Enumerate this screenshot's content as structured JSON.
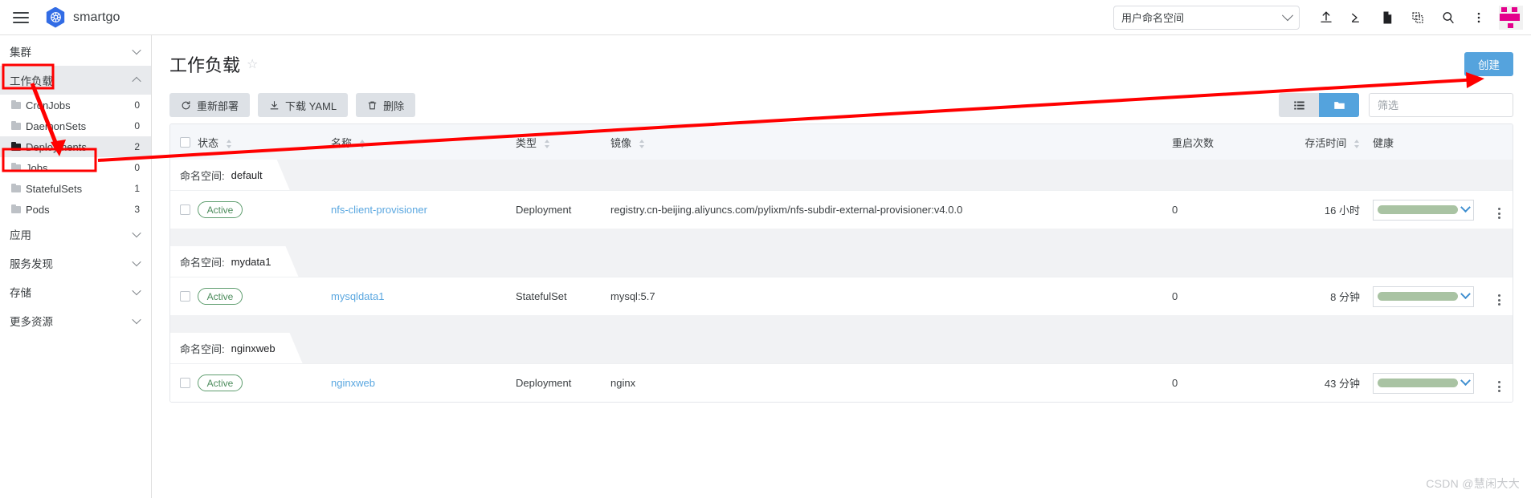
{
  "topbar": {
    "menu_icon": "hamburger-icon",
    "logo_icon": "kubernetes-logo",
    "brand": "smartgo",
    "namespace_select": {
      "value": "用户命名空间",
      "chevron_icon": "chevron-down-icon"
    },
    "icons": [
      {
        "name": "upload-icon",
        "title": "上传"
      },
      {
        "name": "terminal-icon",
        "title": "终端"
      },
      {
        "name": "document-icon",
        "title": "文档"
      },
      {
        "name": "clipboard-icon",
        "title": "剪贴板"
      },
      {
        "name": "search-icon",
        "title": "搜索"
      },
      {
        "name": "more-vertical-icon",
        "title": "更多"
      }
    ],
    "avatar": "user-avatar"
  },
  "sidebar": {
    "groups": [
      {
        "label": "集群",
        "expanded": false,
        "active": false,
        "items": []
      },
      {
        "label": "工作负载",
        "expanded": true,
        "active": true,
        "items": [
          {
            "label": "CronJobs",
            "count": "0",
            "selected": false
          },
          {
            "label": "DaemonSets",
            "count": "0",
            "selected": false
          },
          {
            "label": "Deployments",
            "count": "2",
            "selected": true
          },
          {
            "label": "Jobs",
            "count": "0",
            "selected": false
          },
          {
            "label": "StatefulSets",
            "count": "1",
            "selected": false
          },
          {
            "label": "Pods",
            "count": "3",
            "selected": false
          }
        ]
      },
      {
        "label": "应用",
        "expanded": false,
        "active": false,
        "items": []
      },
      {
        "label": "服务发现",
        "expanded": false,
        "active": false,
        "items": []
      },
      {
        "label": "存储",
        "expanded": false,
        "active": false,
        "items": []
      },
      {
        "label": "更多资源",
        "expanded": false,
        "active": false,
        "items": []
      }
    ]
  },
  "page": {
    "title": "工作负载",
    "star_icon": "star-outline-icon",
    "create_button": "创建"
  },
  "toolbar": {
    "redeploy_label": "重新部署",
    "redeploy_icon": "refresh-icon",
    "download_label": "下载 YAML",
    "download_icon": "download-icon",
    "delete_label": "删除",
    "delete_icon": "trash-icon",
    "view_list_icon": "list-view-icon",
    "view_folder_icon": "folder-view-icon",
    "active_view": "folder",
    "filter_placeholder": "筛选",
    "filter_value": ""
  },
  "table": {
    "columns": {
      "status": "状态",
      "name": "名称",
      "type": "类型",
      "image": "镜像",
      "restarts": "重启次数",
      "age": "存活时间",
      "health": "健康"
    },
    "namespace_key": "命名空间:",
    "groups": [
      {
        "namespace": "default",
        "rows": [
          {
            "status": "Active",
            "name": "nfs-client-provisioner",
            "type": "Deployment",
            "image": "registry.cn-beijing.aliyuncs.com/pylixm/nfs-subdir-external-provisioner:v4.0.0",
            "restarts": "0",
            "age": "16 小时"
          }
        ]
      },
      {
        "namespace": "mydata1",
        "rows": [
          {
            "status": "Active",
            "name": "mysqldata1",
            "type": "StatefulSet",
            "image": "mysql:5.7",
            "restarts": "0",
            "age": "8 分钟"
          }
        ]
      },
      {
        "namespace": "nginxweb",
        "rows": [
          {
            "status": "Active",
            "name": "nginxweb",
            "type": "Deployment",
            "image": "nginx",
            "restarts": "0",
            "age": "43 分钟"
          }
        ]
      }
    ]
  },
  "annotations": {
    "highlight_color": "#ff0000",
    "boxes": [
      "工作负载",
      "Deployments"
    ],
    "arrows": [
      "工作负载→Deployments",
      "Deployments→创建"
    ]
  },
  "watermark": "CSDN @慧闲大大",
  "colors": {
    "accent_blue": "#55a3dd",
    "k8s_blue": "#326ce5",
    "status_green": "#4c8c5c",
    "health_green": "#a9c3a3",
    "annotation_red": "#ff0000"
  }
}
